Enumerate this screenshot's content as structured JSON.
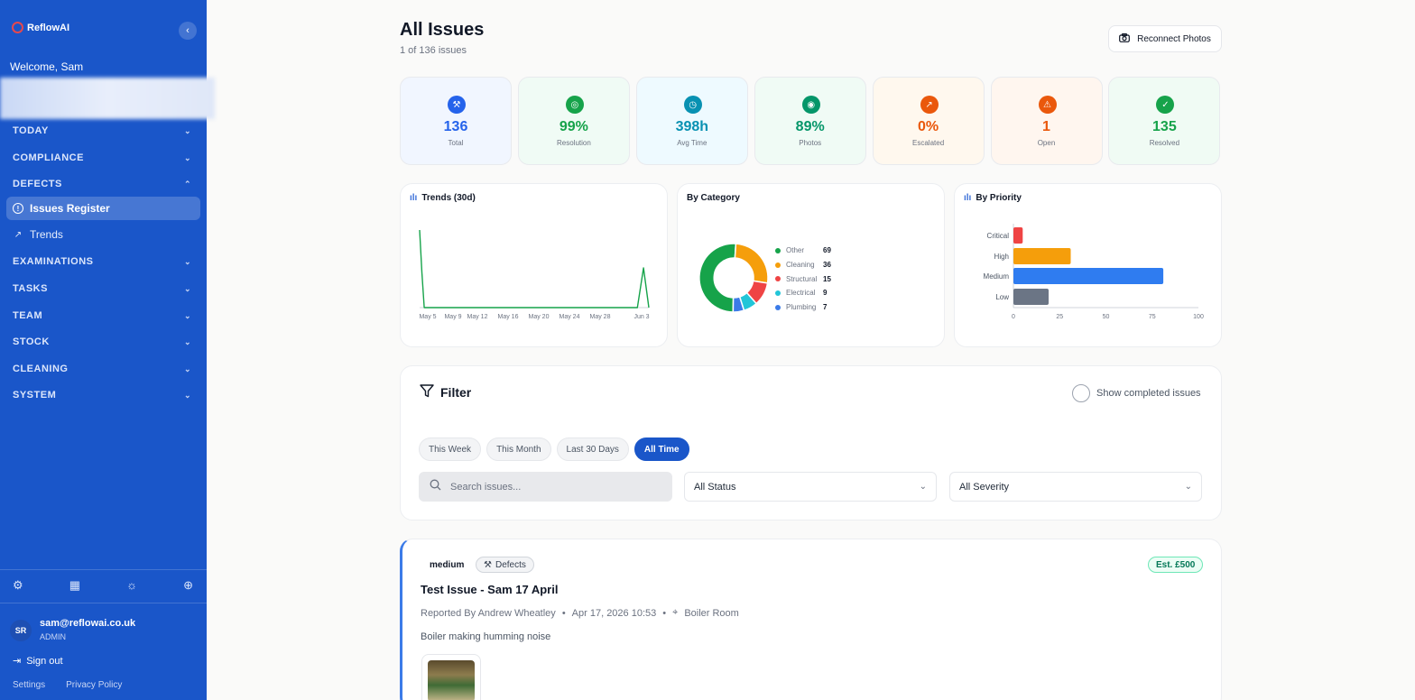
{
  "sidebar": {
    "app_name": "ReflowAI",
    "collapse_icon": "chevron-left-icon",
    "welcome": "Welcome, Sam",
    "sections": [
      {
        "label": "TODAY"
      },
      {
        "label": "COMPLIANCE"
      },
      {
        "label": "DEFECTS"
      },
      {
        "label": "EXAMINATIONS"
      },
      {
        "label": "TASKS"
      },
      {
        "label": "TEAM"
      },
      {
        "label": "STOCK"
      },
      {
        "label": "CLEANING"
      },
      {
        "label": "SYSTEM"
      }
    ],
    "defects_items": [
      {
        "label": "Issues Register",
        "icon": "alert-circle-icon",
        "active": true
      },
      {
        "label": "Trends",
        "icon": "trending-up-icon",
        "active": false
      }
    ],
    "tools": [
      "settings-icon",
      "calendar-icon",
      "sun-icon",
      "globe-icon"
    ],
    "user": {
      "initials": "SR",
      "email": "sam@reflowai.co.uk",
      "role": "ADMIN"
    },
    "sign_out": "Sign out",
    "footer_links": [
      "Settings",
      "Privacy Policy"
    ]
  },
  "header": {
    "title": "All Issues",
    "subtitle": "1 of 136 issues",
    "reconnect_label": "Reconnect Photos"
  },
  "stats": [
    {
      "value": "136",
      "label": "Total",
      "color": "#2563eb",
      "bg": "#f1f6ff",
      "icon": "wrench-icon"
    },
    {
      "value": "99%",
      "label": "Resolution",
      "color": "#16a34a",
      "bg": "#f0fbf5",
      "icon": "target-icon"
    },
    {
      "value": "398h",
      "label": "Avg Time",
      "color": "#0891b2",
      "bg": "#eefaff",
      "icon": "timer-icon"
    },
    {
      "value": "89%",
      "label": "Photos",
      "color": "#059669",
      "bg": "#f0fbf5",
      "icon": "camera-icon"
    },
    {
      "value": "0%",
      "label": "Escalated",
      "color": "#ea580c",
      "bg": "#fff8ee",
      "icon": "arrow-up-right-icon"
    },
    {
      "value": "1",
      "label": "Open",
      "color": "#ea580c",
      "bg": "#fff6ef",
      "icon": "warning-icon"
    },
    {
      "value": "135",
      "label": "Resolved",
      "color": "#16a34a",
      "bg": "#f0fbf4",
      "icon": "check-circle-icon"
    }
  ],
  "chart_data": [
    {
      "type": "line",
      "title": "Trends (30d)",
      "x_ticks": [
        "May 5",
        "May 9",
        "May 12",
        "May 16",
        "May 20",
        "May 24",
        "May 28",
        "Jun 3"
      ],
      "series": [
        {
          "color": "#16a34a",
          "x": [
            0,
            0.3,
            0.6,
            1.5,
            5,
            10,
            15,
            20,
            25,
            27,
            28.5,
            29.3,
            30
          ],
          "y": [
            88,
            40,
            0,
            0,
            0,
            0,
            0,
            0,
            0,
            0,
            0,
            45,
            0
          ]
        }
      ]
    },
    {
      "type": "pie",
      "title": "By Category",
      "labels": [
        "Other",
        "Cleaning",
        "Structural",
        "Electrical",
        "Plumbing"
      ],
      "values": [
        69,
        36,
        15,
        9,
        7
      ],
      "colors": [
        "#16a34a",
        "#f59e0b",
        "#ef4444",
        "#22c5d8",
        "#3b7be8"
      ]
    },
    {
      "type": "bar",
      "title": "By Priority",
      "orientation": "horizontal",
      "categories": [
        "Critical",
        "High",
        "Medium",
        "Low"
      ],
      "values": [
        5,
        31,
        81,
        19
      ],
      "colors": [
        "#ef4444",
        "#f59e0b",
        "#2f7cf0",
        "#6b7585"
      ],
      "xlim": [
        0,
        100
      ],
      "x_ticks": [
        "0",
        "25",
        "50",
        "75",
        "100"
      ]
    }
  ],
  "filter": {
    "title": "Filter",
    "show_completed_label": "Show completed issues",
    "time_options": [
      {
        "label": "This Week",
        "active": false
      },
      {
        "label": "This Month",
        "active": false
      },
      {
        "label": "Last 30 Days",
        "active": false
      },
      {
        "label": "All Time",
        "active": true
      }
    ],
    "search_placeholder": "Search issues...",
    "status_value": "All Status",
    "severity_value": "All Severity"
  },
  "issue": {
    "severity": "medium",
    "category": "Defects",
    "estimate": "Est. £500",
    "title": "Test Issue - Sam 17 April",
    "reported_by": "Reported By Andrew Wheatley",
    "date": "Apr 17, 2026 10:53",
    "location": "Boiler Room",
    "description": "Boiler making humming noise"
  }
}
